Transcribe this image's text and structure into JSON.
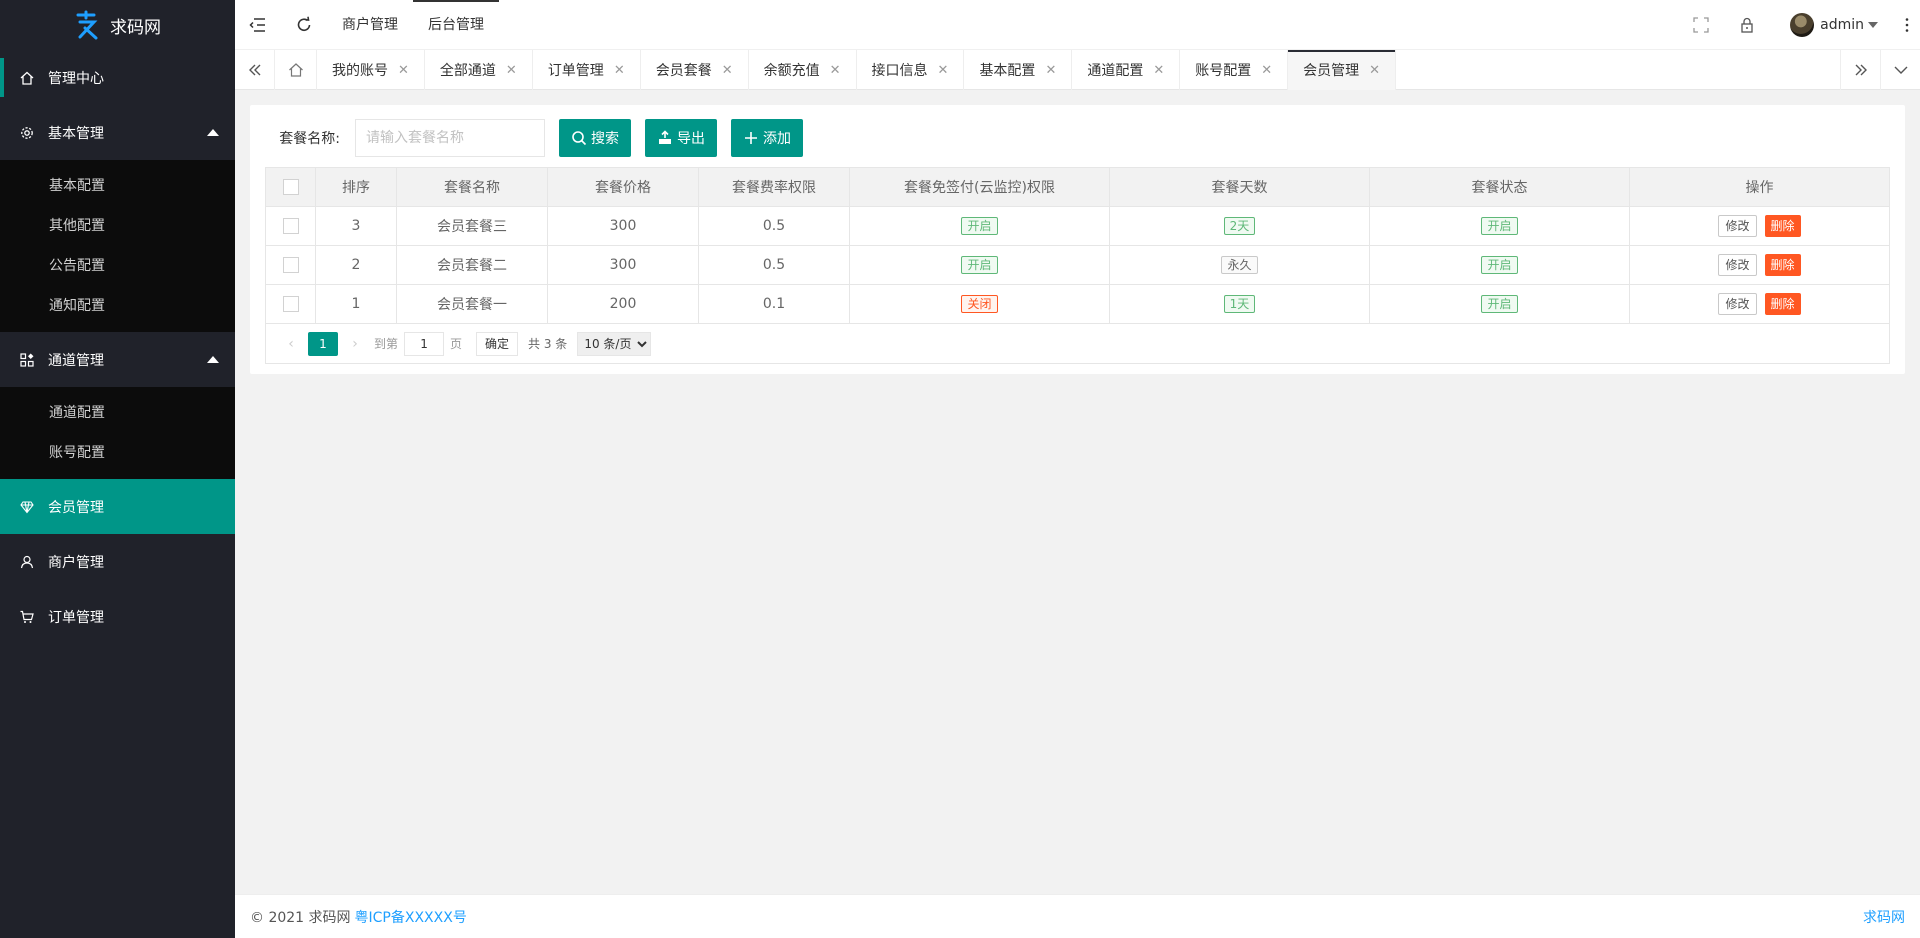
{
  "app": {
    "name": "求码网"
  },
  "sidebar": {
    "items": [
      {
        "label": "管理中心",
        "icon": "home-icon"
      },
      {
        "label": "基本管理",
        "icon": "gear-icon",
        "children": [
          "基本配置",
          "其他配置",
          "公告配置",
          "通知配置"
        ]
      },
      {
        "label": "通道管理",
        "icon": "apps-icon",
        "children": [
          "通道配置",
          "账号配置"
        ]
      },
      {
        "label": "会员管理",
        "icon": "diamond-icon"
      },
      {
        "label": "商户管理",
        "icon": "user-icon"
      },
      {
        "label": "订单管理",
        "icon": "cart-icon"
      }
    ]
  },
  "header": {
    "links": [
      "商户管理",
      "后台管理"
    ],
    "user": "admin"
  },
  "tabs": [
    "我的账号",
    "全部通道",
    "订单管理",
    "会员套餐",
    "余额充值",
    "接口信息",
    "基本配置",
    "通道配置",
    "账号配置",
    "会员管理"
  ],
  "search": {
    "label": "套餐名称:",
    "placeholder": "请输入套餐名称",
    "buttons": {
      "search": "搜索",
      "export": "导出",
      "add": "添加"
    }
  },
  "table": {
    "columns": [
      "排序",
      "套餐名称",
      "套餐价格",
      "套餐费率权限",
      "套餐免签付(云监控)权限",
      "套餐天数",
      "套餐状态",
      "操作"
    ],
    "rows": [
      {
        "sort": "3",
        "name": "会员套餐三",
        "price": "300",
        "rate": "0.5",
        "free": "开启",
        "days": "2天",
        "status": "开启"
      },
      {
        "sort": "2",
        "name": "会员套餐二",
        "price": "300",
        "rate": "0.5",
        "free": "开启",
        "days": "永久",
        "status": "开启"
      },
      {
        "sort": "1",
        "name": "会员套餐一",
        "price": "200",
        "rate": "0.1",
        "free": "关闭",
        "days": "1天",
        "status": "开启"
      }
    ],
    "actions": {
      "edit": "修改",
      "delete": "删除"
    }
  },
  "pagination": {
    "current": "1",
    "goto_label": "到第",
    "goto_value": "1",
    "page_label": "页",
    "confirm": "确定",
    "total": "共 3 条",
    "page_size": "10 条/页"
  },
  "footer": {
    "copyright": "© 2021 求码网",
    "icp": "粤ICP备XXXXX号",
    "right": "求码网"
  },
  "colors": {
    "primary": "#009688",
    "sidebar": "#20222a",
    "danger": "#ff5722",
    "success": "#5fb878"
  }
}
